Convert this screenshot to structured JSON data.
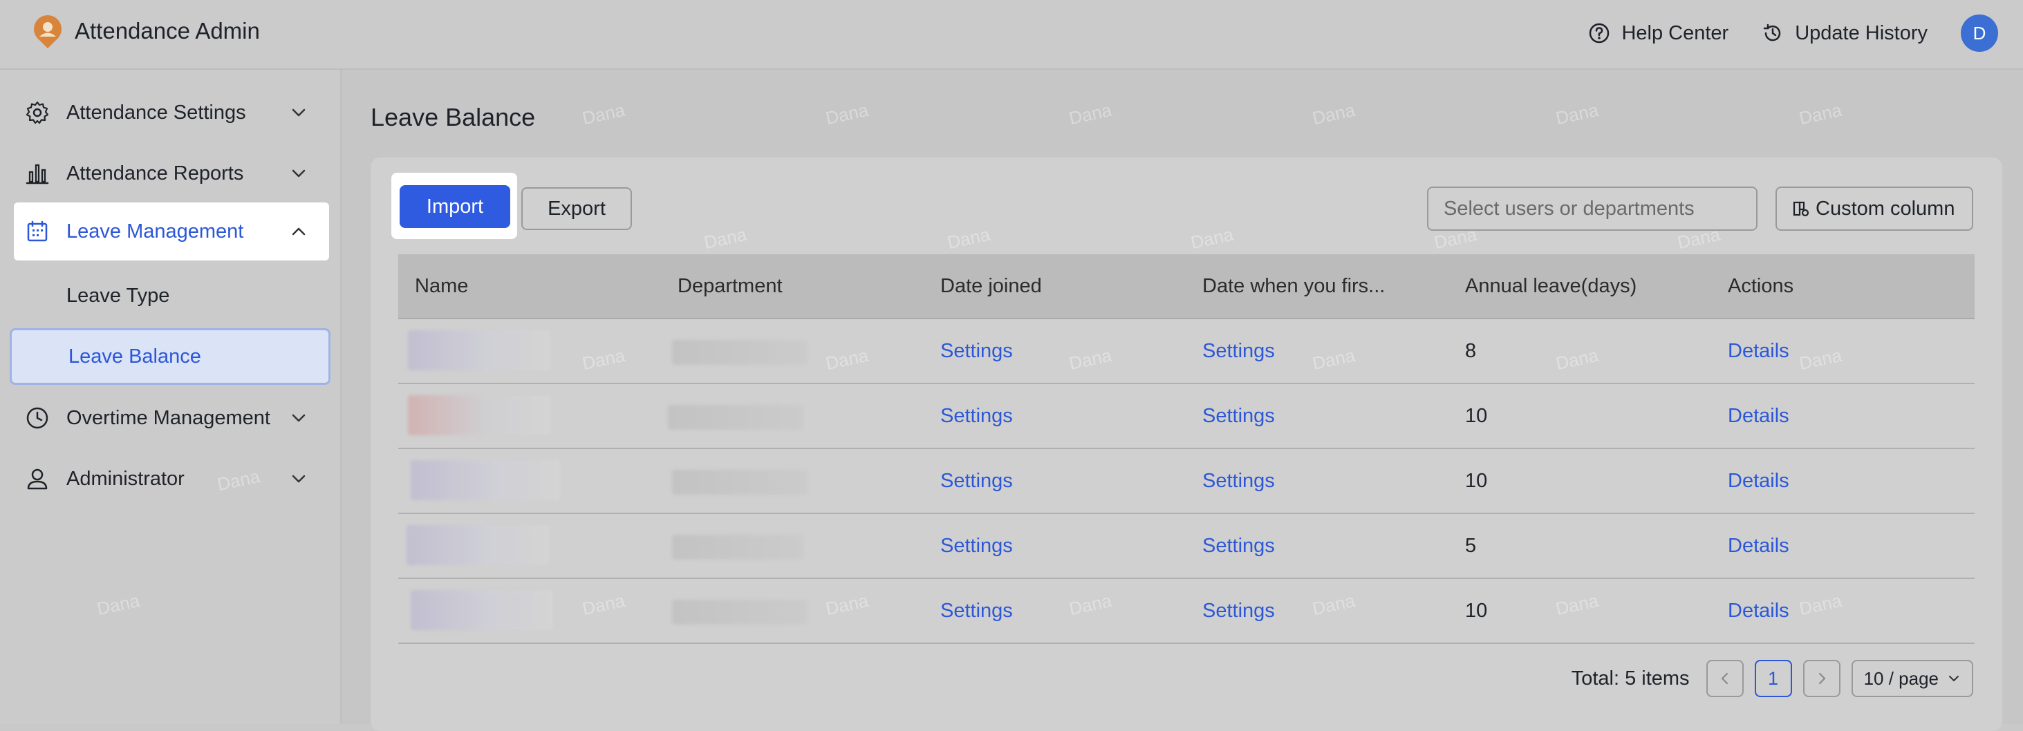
{
  "app": {
    "title": "Attendance Admin",
    "avatar_letter": "D"
  },
  "header": {
    "help_center": "Help Center",
    "update_history": "Update History"
  },
  "sidebar": {
    "items": [
      {
        "label": "Attendance Settings",
        "icon": "gear-icon"
      },
      {
        "label": "Attendance Reports",
        "icon": "bar-chart-icon"
      },
      {
        "label": "Leave Management",
        "icon": "calendar-icon",
        "active": true
      },
      {
        "label": "Overtime Management",
        "icon": "clock-icon"
      },
      {
        "label": "Administrator",
        "icon": "user-icon"
      }
    ],
    "sub_items": [
      {
        "label": "Leave Type"
      },
      {
        "label": "Leave Balance",
        "selected": true
      }
    ]
  },
  "main": {
    "page_title": "Leave Balance",
    "toolbar": {
      "import_label": "Import",
      "export_label": "Export",
      "search_placeholder": "Select users or departments",
      "custom_column_label": "Custom column"
    },
    "table": {
      "columns": [
        "Name",
        "Department",
        "Date joined",
        "Date when you firs...",
        "Annual leave(days)",
        "Actions"
      ],
      "rows": [
        {
          "date_joined": "Settings",
          "date_first": "Settings",
          "annual_leave": "8",
          "action": "Details"
        },
        {
          "date_joined": "Settings",
          "date_first": "Settings",
          "annual_leave": "10",
          "action": "Details"
        },
        {
          "date_joined": "Settings",
          "date_first": "Settings",
          "annual_leave": "10",
          "action": "Details"
        },
        {
          "date_joined": "Settings",
          "date_first": "Settings",
          "annual_leave": "5",
          "action": "Details"
        },
        {
          "date_joined": "Settings",
          "date_first": "Settings",
          "annual_leave": "10",
          "action": "Details"
        }
      ]
    },
    "pagination": {
      "total": "Total: 5 items",
      "current_page": "1",
      "page_size": "10 / page"
    }
  },
  "watermark": "Dana",
  "colors": {
    "accent": "#2f5be0",
    "link": "#2b57d8",
    "overlay": "#c9c9c9"
  }
}
